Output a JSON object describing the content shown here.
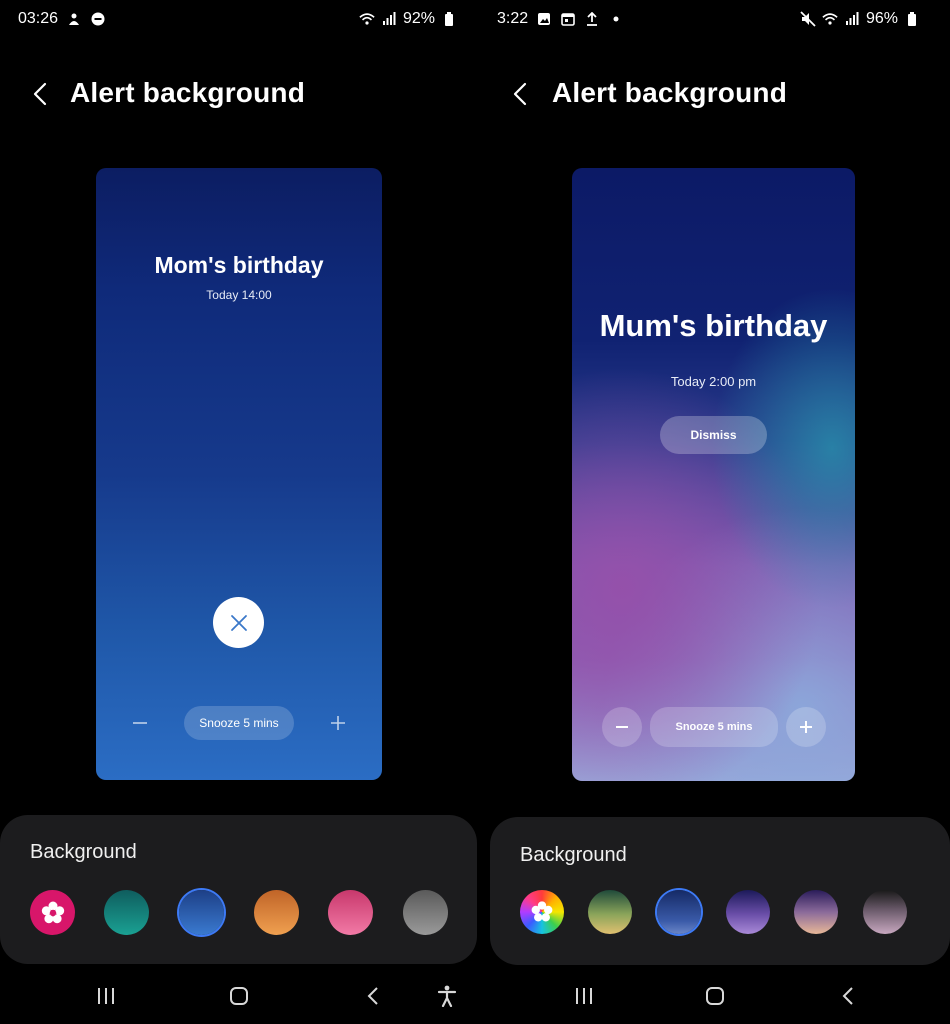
{
  "left": {
    "status": {
      "time": "03:26",
      "battery": "92%"
    },
    "header": {
      "title": "Alert background"
    },
    "preview": {
      "title": "Mom's birthday",
      "time": "Today 14:00",
      "snooze": "Snooze 5 mins"
    },
    "background": {
      "label": "Background",
      "swatches": [
        {
          "name": "gallery",
          "color": "#d8166a"
        },
        {
          "name": "teal",
          "color": "#178a86"
        },
        {
          "name": "blue",
          "color": "#2a5cb0",
          "selected": true
        },
        {
          "name": "orange",
          "color": "#e08a3c"
        },
        {
          "name": "pink",
          "color": "#e2578a"
        },
        {
          "name": "grey",
          "color": "#7a7a7a"
        }
      ]
    }
  },
  "right": {
    "status": {
      "time": "3:22",
      "battery": "96%"
    },
    "header": {
      "title": "Alert background"
    },
    "preview": {
      "title": "Mum's birthday",
      "time": "Today 2:00 pm",
      "dismiss": "Dismiss",
      "snooze": "Snooze 5 mins"
    },
    "background": {
      "label": "Background",
      "swatches": [
        {
          "name": "gallery"
        },
        {
          "name": "green-gold"
        },
        {
          "name": "blue",
          "selected": true
        },
        {
          "name": "purple"
        },
        {
          "name": "peach"
        },
        {
          "name": "mauve"
        }
      ]
    }
  }
}
